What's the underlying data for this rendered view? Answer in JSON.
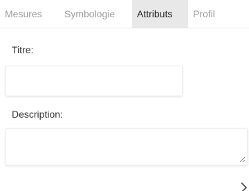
{
  "tabs": [
    {
      "label": "Mesures",
      "active": false
    },
    {
      "label": "Symbologie",
      "active": false
    },
    {
      "label": "Attributs",
      "active": true
    },
    {
      "label": "Profil",
      "active": false
    }
  ],
  "form": {
    "title_label": "Titre:",
    "title_value": "",
    "description_label": "Description:",
    "description_value": ""
  },
  "icons": {
    "resize": "resize-grip-icon",
    "chevron": "chevron-right-icon"
  },
  "colors": {
    "active_tab_bg": "#e8e8e8",
    "inactive_tab_text": "#9a9a9a",
    "active_tab_text": "#222222"
  }
}
